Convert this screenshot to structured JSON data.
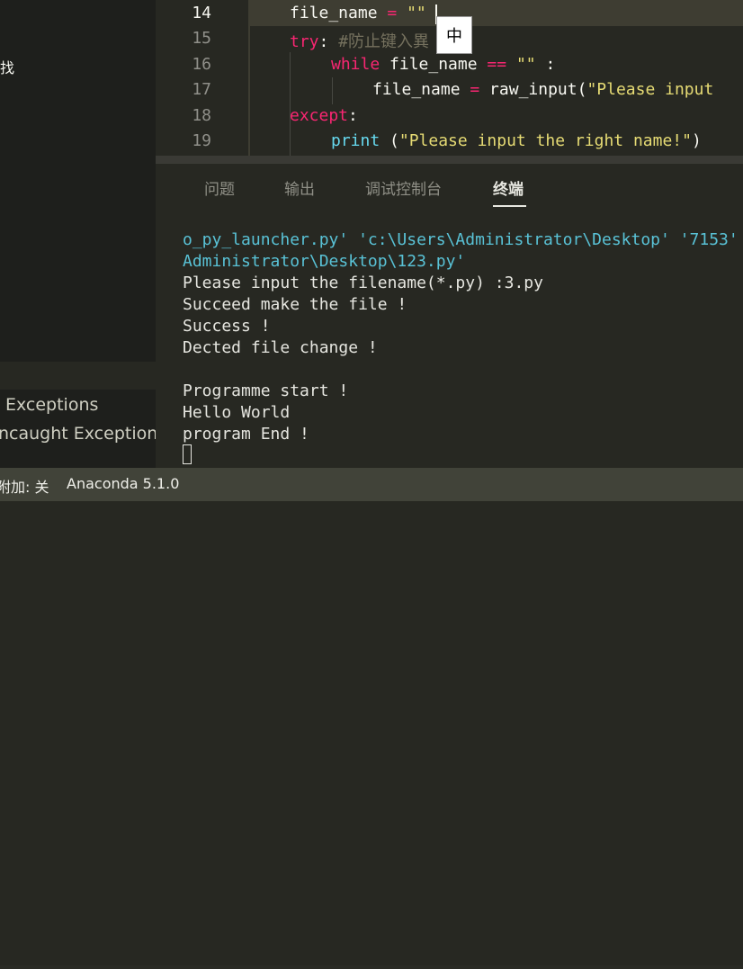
{
  "sidebar": {
    "find_label": "找",
    "breakpoints": [
      {
        "label": "Exceptions"
      },
      {
        "label": "ncaught Exceptions"
      }
    ]
  },
  "editor": {
    "lines": [
      {
        "number": "14",
        "active": true
      },
      {
        "number": "15"
      },
      {
        "number": "16"
      },
      {
        "number": "17"
      },
      {
        "number": "18"
      },
      {
        "number": "19"
      }
    ],
    "code": {
      "l14_var": "file_name",
      "l14_op": " = ",
      "l14_str": "\"\"",
      "l15_kw": "try",
      "l15_colon": ": ",
      "l15_comment": "#防止键入異",
      "l16_kw": "while",
      "l16_var": " file_name ",
      "l16_op": "==",
      "l16_space": " ",
      "l16_str": "\"\"",
      "l16_colon": " :",
      "l17_var": "file_name ",
      "l17_op": "=",
      "l17_call": " raw_input(",
      "l17_str": "\"Please input ",
      "l18_kw": "except",
      "l18_colon": ":",
      "l19_fn": "print",
      "l19_paren": " (",
      "l19_str": "\"Please input the right name!\"",
      "l19_close": ")"
    },
    "ime_char": "中"
  },
  "panel": {
    "tabs": [
      {
        "label": "问题"
      },
      {
        "label": "输出"
      },
      {
        "label": "调试控制台"
      },
      {
        "label": "终端",
        "active": true
      }
    ],
    "terminal_lines": [
      "o_py_launcher.py' 'c:\\Users\\Administrator\\Desktop' '7153'",
      "Administrator\\Desktop\\123.py'",
      "Please input the filename(*.py) :3.py",
      "Succeed make the file !",
      "Success !",
      "Dected file change !",
      "",
      "Programme start !",
      "Hello World",
      "program End !"
    ]
  },
  "statusbar": {
    "left_text": "附加: 关",
    "interpreter": "Anaconda 5.1.0"
  },
  "colors": {
    "background": "#272822",
    "sidebar": "#1e1f1c",
    "keyword": "#f92672",
    "builtin": "#66d9ef",
    "string": "#e6db74",
    "comment": "#75715e",
    "terminal_path": "#59c2d6",
    "statusbar": "#414339"
  }
}
